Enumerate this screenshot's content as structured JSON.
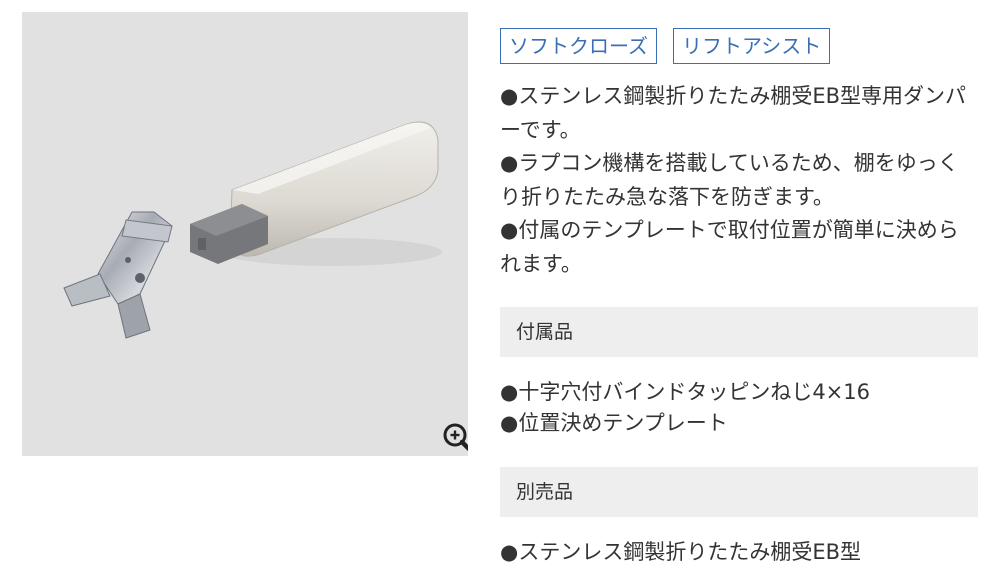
{
  "tags": [
    {
      "label": "ソフトクローズ"
    },
    {
      "label": "リフトアシスト"
    }
  ],
  "description": [
    "●ステンレス鋼製折りたたみ棚受EB型専用ダンパーです。",
    "●ラプコン機構を搭載しているため、棚をゆっくり折りたたみ急な落下を防ぎます。",
    "●付属のテンプレートで取付位置が簡単に決められます。"
  ],
  "accessories": {
    "header": "付属品",
    "items": [
      "●十字穴付バインドタッピンねじ4×16",
      "●位置決めテンプレート"
    ]
  },
  "sold_separately": {
    "header": "別売品",
    "items": [
      "●ステンレス鋼製折りたたみ棚受EB型"
    ]
  },
  "icons": {
    "zoom": "zoom-in-icon"
  },
  "colors": {
    "tag_border": "#3a6fb6",
    "image_background": "#e1e1e2",
    "section_background": "#eeeeee"
  }
}
